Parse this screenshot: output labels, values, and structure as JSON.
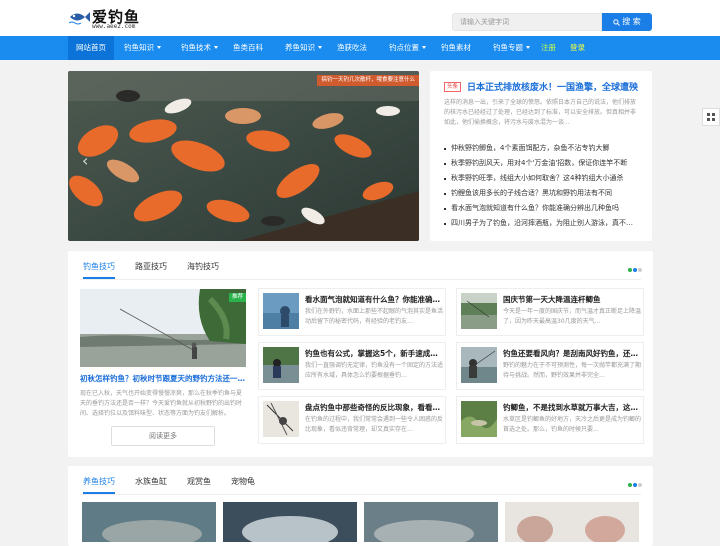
{
  "header": {
    "logo_text": "爱钓鱼",
    "logo_url": "www.aee2.com",
    "search_placeholder": "请输入关键字词",
    "search_button": "搜 索"
  },
  "nav": {
    "items": [
      {
        "label": "网站首页",
        "active": true,
        "dropdown": false
      },
      {
        "label": "钓鱼知识",
        "active": false,
        "dropdown": true
      },
      {
        "label": "钓鱼技术",
        "active": false,
        "dropdown": true
      },
      {
        "label": "鱼类百科",
        "active": false,
        "dropdown": false
      },
      {
        "label": "养鱼知识",
        "active": false,
        "dropdown": true
      },
      {
        "label": "渔获吃法",
        "active": false,
        "dropdown": false
      },
      {
        "label": "钓点位置",
        "active": false,
        "dropdown": true
      },
      {
        "label": "钓鱼素材",
        "active": false,
        "dropdown": false
      },
      {
        "label": "钓鱼专题",
        "active": false,
        "dropdown": true
      }
    ],
    "register": "注册",
    "login": "登录"
  },
  "slider": {
    "caption": "搞钓一天钓几次散杆，哦食要注意什么",
    "prev": "‹"
  },
  "headline": {
    "badge": "头条",
    "title": "日本正式排放核废水！一国渔擎，全球遭殃",
    "desc": "这样的消息一出，引来了全球的愤怒。依照日本方自己的说法，他们排放的核污水已经经过了处理，已经达到了标准，可以安全排放。但真相并非如此，他们偷换概念，将污水与废水混为一谈...",
    "list": [
      "仲秋野钓鲫鱼，4个素面饵配方，杂鱼不沾专钓大鲫",
      "秋季野钓刮风天，用对4个'万金油'招数，保证你连竿不断",
      "秋季野钓旺季，线组大小如何取舍？这4种钓组大小通杀",
      "钓鲤鱼该用多长的子线合适？黑坑和野钓用法有不同",
      "看水面气泡就知道有什么鱼？你能准确分辨出几种鱼吗",
      "四川男子为了钓鱼，沿河摔酒瓶，为阻止别人游泳，真不应该"
    ]
  },
  "section1": {
    "tabs": [
      "钓鱼技巧",
      "路亚技巧",
      "海钓技巧"
    ],
    "feature": {
      "badge": "推荐",
      "title": "初秋怎样钓鱼？初秋时节跟夏天的野钓方法还一样吗",
      "desc": "现在已入秋，天气也开始变得慢慢凉爽，那么在秋季钓鱼与夏天的垂钓方法还是否一样？今天爱钓鱼就从初秋野钓的出钓时间、选择钓位以及饵料味型、状态等方面为钓友们解析。",
      "more": "阅读更多"
    },
    "cards": [
      {
        "title": "看水面气泡就知道有什么鱼？你能准确分辨出几种",
        "desc": "我们在外野钓，水面上那些不起眼的气泡其实是鱼活动后留下的秘密代码，有经验的老钓友..."
      },
      {
        "title": "国庆节第一天大降温连杆鲫鱼",
        "desc": "今天是一年一度的国庆节，而气温才真正断足上降温了，因为昨天最高温30几度的天气..."
      },
      {
        "title": "钓鱼也有公式，掌握这5个，新手速成大师",
        "desc": "我们一直强调钓无定律，钓鱼没有一个固定的方法适应所有水域，具体怎么钓要根据垂钓..."
      },
      {
        "title": "钓鱼还要看风向？是刮南风好钓鱼，还是北风",
        "desc": "野钓的魅力在于不可预测性，每一次抛竿都充满了期待与挑战。然而，野钓效果并非完全..."
      },
      {
        "title": "盘点钓鱼中那些奇怪的反比现象，看看你遇到过",
        "desc": "在钓鱼的过程中，我们常常会遇到一些令人困惑的反比现象，看似违背常理，却又真实存在..."
      },
      {
        "title": "钓鲫鱼，不是找到水草就万事大吉，这几种草",
        "desc": "水草区是钓鲫鱼的好地方，天冷之后更是成为钓鲫的首选之处。那么，钓鱼的时候只要..."
      }
    ]
  },
  "section2": {
    "tabs": [
      "养鱼技巧",
      "水族鱼缸",
      "观赏鱼",
      "宠物龟"
    ]
  },
  "colors": {
    "nav_bg": "#1a8cf0",
    "nav_active": "#0c74d8",
    "accent_blue": "#1a7ee6",
    "recommend_green": "#2ab24b",
    "headline_red": "#e33"
  }
}
